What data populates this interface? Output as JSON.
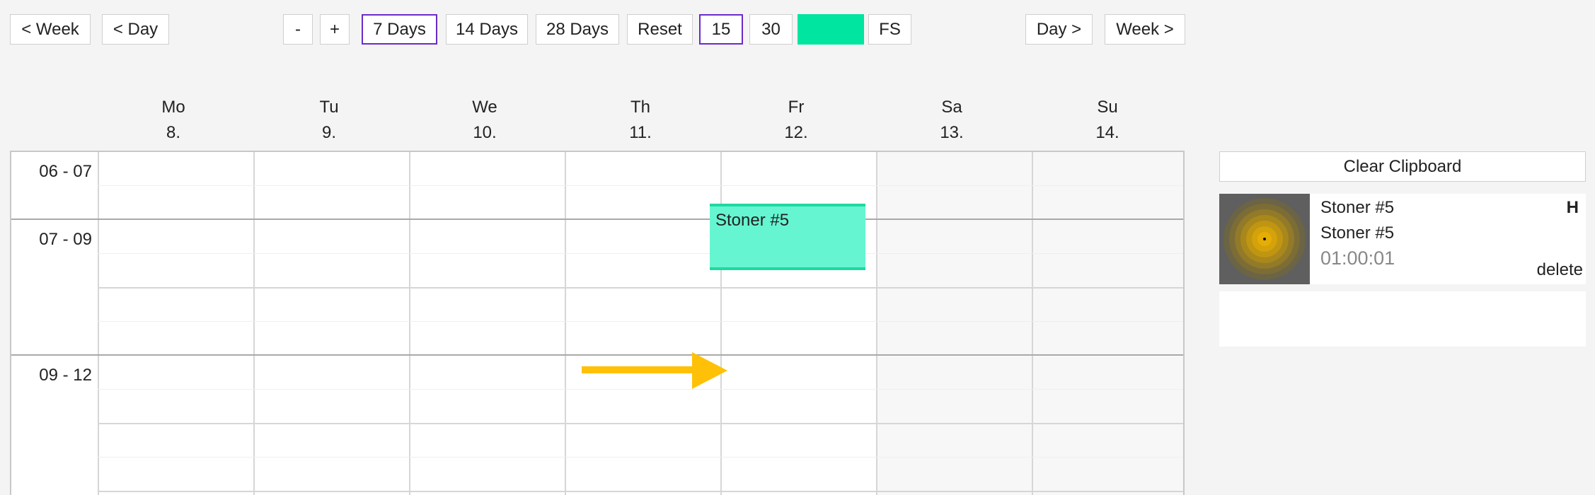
{
  "toolbar": {
    "prev_week": "< Week",
    "prev_day": "< Day",
    "zoom_out": "-",
    "zoom_in": "+",
    "days_7": "7 Days",
    "days_14": "14 Days",
    "days_28": "28 Days",
    "reset": "Reset",
    "interval_15": "15",
    "interval_30": "30",
    "color_swatch": "#00e5a0",
    "fullscreen": "FS",
    "next_day": "Day >",
    "next_week": "Week >",
    "active_range": "7 Days",
    "active_interval": "15"
  },
  "days": [
    {
      "name": "Mo",
      "date": "8."
    },
    {
      "name": "Tu",
      "date": "9."
    },
    {
      "name": "We",
      "date": "10."
    },
    {
      "name": "Th",
      "date": "11."
    },
    {
      "name": "Fr",
      "date": "12."
    },
    {
      "name": "Sa",
      "date": "13."
    },
    {
      "name": "Su",
      "date": "14."
    }
  ],
  "time_slots": [
    "06 - 07",
    "07 - 09",
    "09 - 12"
  ],
  "event": {
    "title": "Stoner #5",
    "day": "Fr",
    "color": "#66f5d1"
  },
  "clipboard": {
    "clear_label": "Clear Clipboard",
    "item": {
      "title": "Stoner #5",
      "subtitle": "Stoner #5",
      "duration": "01:00:01",
      "badge": "H",
      "delete_label": "delete",
      "thumb_icon": "concentric-circles-icon"
    }
  },
  "annotation": {
    "icon": "arrow-right-icon",
    "color": "#ffc107"
  }
}
